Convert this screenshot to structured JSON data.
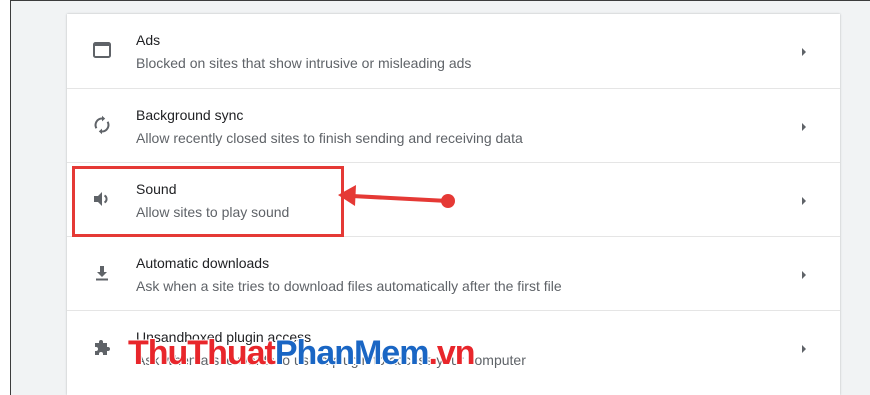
{
  "settings": {
    "items": [
      {
        "title": "Ads",
        "description": "Blocked on sites that show intrusive or misleading ads",
        "icon": "web-asset-icon"
      },
      {
        "title": "Background sync",
        "description": "Allow recently closed sites to finish sending and receiving data",
        "icon": "sync-icon"
      },
      {
        "title": "Sound",
        "description": "Allow sites to play sound",
        "icon": "volume-icon"
      },
      {
        "title": "Automatic downloads",
        "description": "Ask when a site tries to download files automatically after the first file",
        "icon": "download-icon"
      },
      {
        "title": "Unsandboxed plugin access",
        "description": "Ask when a site wants to use a plugin to access your computer",
        "icon": "puzzle-icon"
      }
    ]
  },
  "annotation": {
    "highlight_color": "#e53935"
  },
  "watermark": {
    "part1": "ThuThuat",
    "part2": "PhanMem",
    "part3": ".vn"
  },
  "colors": {
    "title": "#202124",
    "description": "#5f6368",
    "icon": "#5f6368",
    "watermark_red": "#e8262b",
    "watermark_blue": "#1a66c4"
  }
}
